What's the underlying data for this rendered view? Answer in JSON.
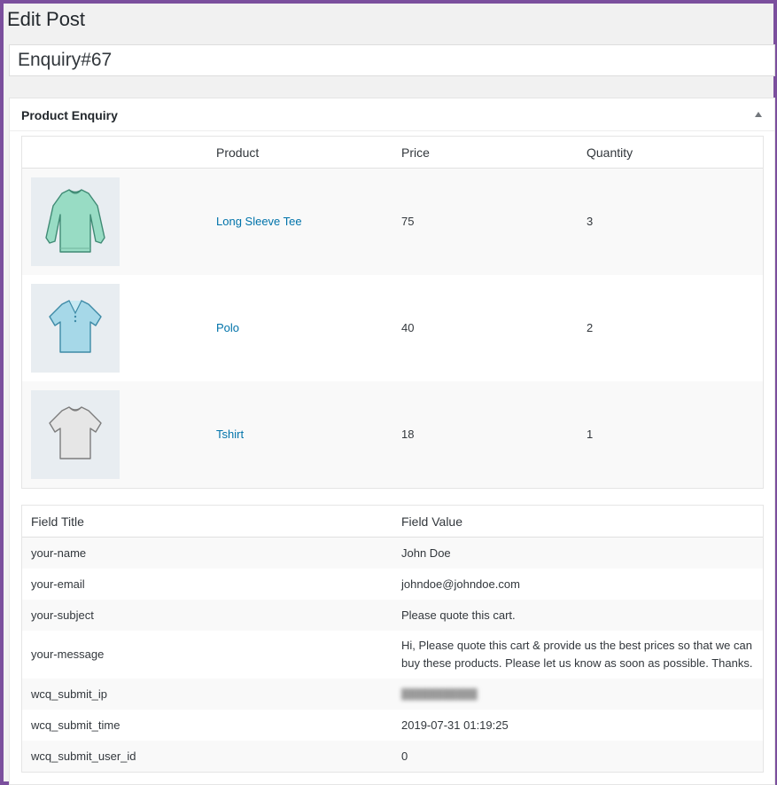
{
  "page": {
    "title": "Edit Post"
  },
  "post": {
    "title_value": "Enquiry#67"
  },
  "metabox": {
    "title": "Product Enquiry"
  },
  "products_table": {
    "headers": [
      "",
      "Product",
      "Price",
      "Quantity"
    ],
    "rows": [
      {
        "image": "long-sleeve-tee-image",
        "name": "Long Sleeve Tee",
        "price": "75",
        "quantity": "3"
      },
      {
        "image": "polo-image",
        "name": "Polo",
        "price": "40",
        "quantity": "2"
      },
      {
        "image": "tshirt-image",
        "name": "Tshirt",
        "price": "18",
        "quantity": "1"
      }
    ]
  },
  "fields_table": {
    "headers": [
      "Field Title",
      "Field Value"
    ],
    "rows": [
      {
        "title": "your-name",
        "value": "John Doe"
      },
      {
        "title": "your-email",
        "value": "johndoe@johndoe.com"
      },
      {
        "title": "your-subject",
        "value": "Please quote this cart."
      },
      {
        "title": "your-message",
        "value": "Hi, Please quote this cart & provide us the best prices so that we can buy these products. Please let us know as soon as possible. Thanks."
      },
      {
        "title": "wcq_submit_ip",
        "value": "",
        "obscured": true
      },
      {
        "title": "wcq_submit_time",
        "value": "2019-07-31 01:19:25"
      },
      {
        "title": "wcq_submit_user_id",
        "value": "0"
      }
    ]
  },
  "colors": {
    "frame_border": "#7b4f9d",
    "link": "#0073aa",
    "page_bg": "#f1f1f1"
  }
}
